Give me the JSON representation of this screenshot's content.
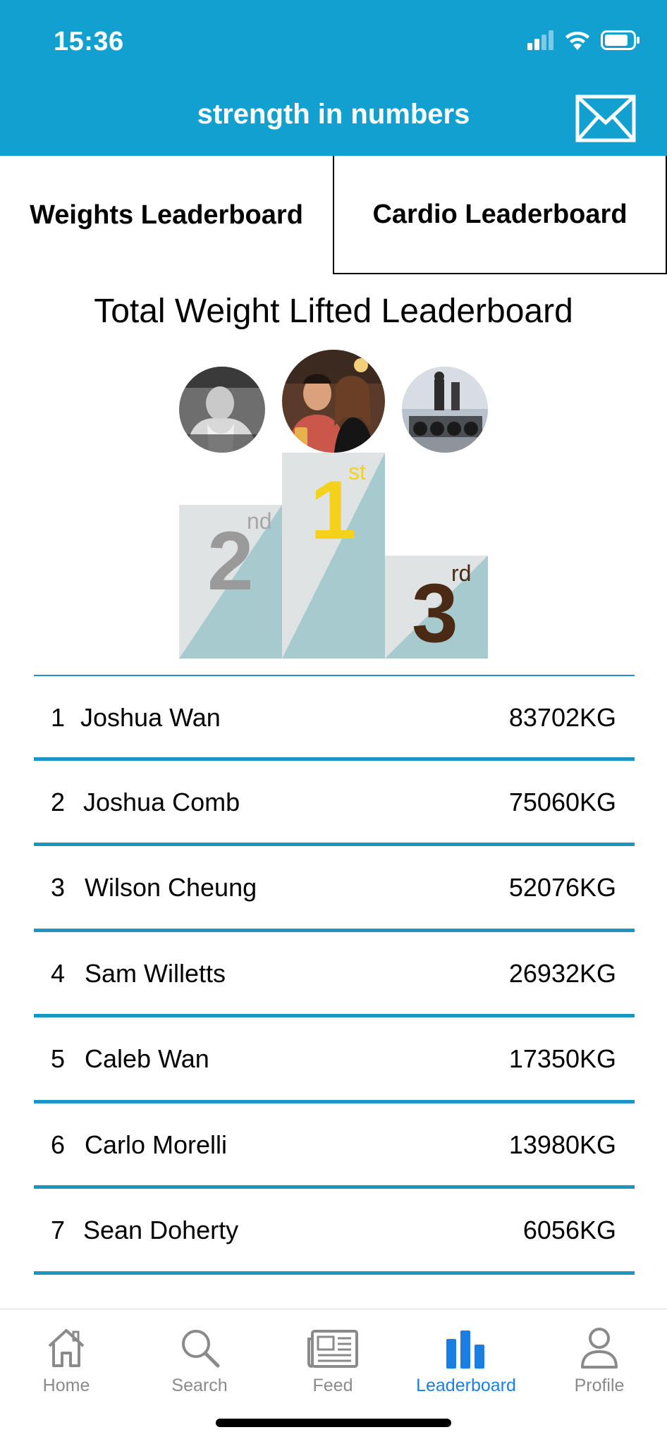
{
  "status_bar": {
    "time": "15:36"
  },
  "header": {
    "title": "strength in numbers",
    "mail_icon": "envelope-icon"
  },
  "tabs": [
    {
      "label": "Weights Leaderboard",
      "selected": true
    },
    {
      "label": "Cardio Leaderboard",
      "selected": false
    }
  ],
  "board": {
    "title": "Total Weight Lifted Leaderboard",
    "podium": {
      "first": {
        "digit": "1",
        "suffix": "st"
      },
      "second": {
        "digit": "2",
        "suffix": "nd"
      },
      "third": {
        "digit": "3",
        "suffix": "rd"
      }
    }
  },
  "leaderboard": [
    {
      "rank": "1",
      "name": "Joshua Wan",
      "score": "83702KG"
    },
    {
      "rank": "2",
      "name": "Joshua Comb",
      "score": "75060KG"
    },
    {
      "rank": "3",
      "name": "Wilson Cheung",
      "score": "52076KG"
    },
    {
      "rank": "4",
      "name": "Sam Willetts",
      "score": "26932KG"
    },
    {
      "rank": "5",
      "name": "Caleb Wan",
      "score": "17350KG"
    },
    {
      "rank": "6",
      "name": "Carlo Morelli",
      "score": "13980KG"
    },
    {
      "rank": "7",
      "name": "Sean Doherty",
      "score": "6056KG"
    }
  ],
  "nav": [
    {
      "label": "Home",
      "icon": "home-icon"
    },
    {
      "label": "Search",
      "icon": "search-icon"
    },
    {
      "label": "Feed",
      "icon": "newspaper-icon"
    },
    {
      "label": "Leaderboard",
      "icon": "bar-chart-icon",
      "active": true
    },
    {
      "label": "Profile",
      "icon": "person-icon"
    }
  ],
  "colors": {
    "header": "#12a0d1",
    "accent": "#1a7fe3",
    "divider": "#1b95c4",
    "gold": "#f2d21b",
    "silver": "#9a9a9a",
    "bronze": "#4a2a14"
  }
}
